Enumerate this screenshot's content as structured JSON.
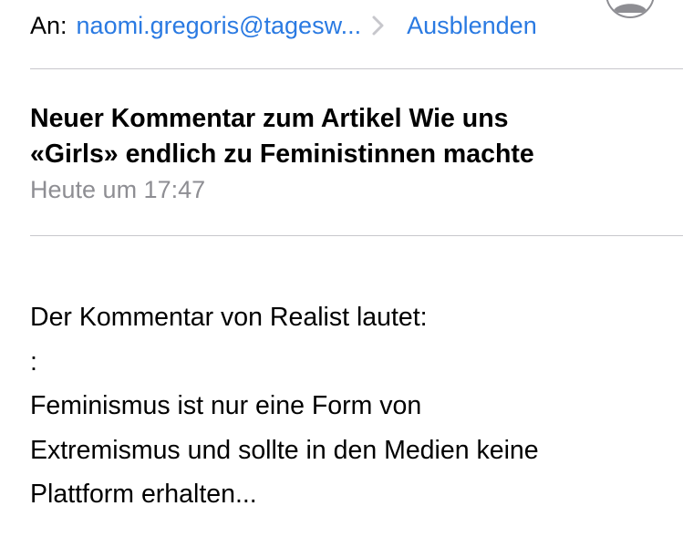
{
  "header": {
    "to_label": "An:",
    "to_address": "naomi.gregoris@tagesw...",
    "hide_label": "Ausblenden",
    "accent_color": "#2a7ae2",
    "chevron_icon": "chevron-right-icon",
    "avatar_icon": "person-avatar-icon"
  },
  "message": {
    "subject_line1": "Neuer Kommentar zum Artikel Wie uns",
    "subject_line2": "«Girls» endlich zu Feministinnen machte",
    "timestamp": "Heute um 17:47",
    "body_lines": [
      "Der Kommentar von Realist lautet:",
      ":",
      "Feminismus ist nur eine Form von",
      "Extremismus und sollte in den Medien keine",
      "Plattform erhalten..."
    ]
  }
}
